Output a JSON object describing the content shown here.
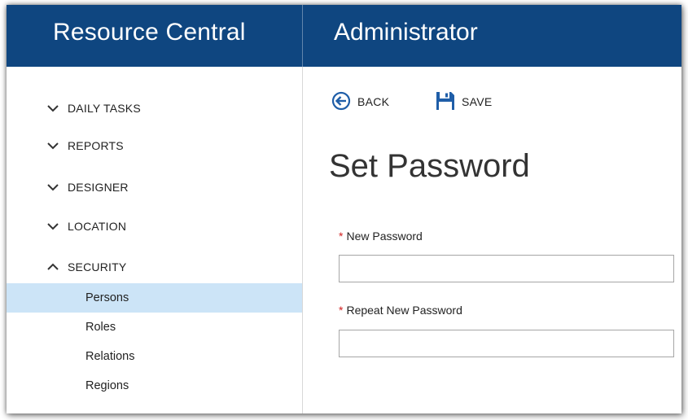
{
  "header": {
    "app_title": "Resource Central",
    "section_title": "Administrator"
  },
  "sidebar": {
    "groups": [
      {
        "label": "DAILY TASKS",
        "expanded": false,
        "icon": "chevron-down-icon"
      },
      {
        "label": "REPORTS",
        "expanded": false,
        "icon": "chevron-down-icon"
      },
      {
        "label": "DESIGNER",
        "expanded": false,
        "icon": "chevron-down-icon"
      },
      {
        "label": "LOCATION",
        "expanded": false,
        "icon": "chevron-down-icon"
      },
      {
        "label": "SECURITY",
        "expanded": true,
        "icon": "chevron-up-icon"
      }
    ],
    "security_items": [
      {
        "label": "Persons",
        "active": true
      },
      {
        "label": "Roles",
        "active": false
      },
      {
        "label": "Relations",
        "active": false
      },
      {
        "label": "Regions",
        "active": false
      }
    ]
  },
  "toolbar": {
    "back_label": "BACK",
    "back_icon": "back-arrow-icon",
    "save_label": "SAVE",
    "save_icon": "floppy-disk-icon"
  },
  "form": {
    "title": "Set Password",
    "required_marker": "*",
    "fields": [
      {
        "label": "New Password",
        "value": "",
        "placeholder": ""
      },
      {
        "label": "Repeat New Password",
        "value": "",
        "placeholder": ""
      }
    ]
  },
  "colors": {
    "header_bg": "#0f4680",
    "active_item_bg": "#cce4f7",
    "icon_blue": "#1f5ea8",
    "required_red": "#d12020"
  }
}
